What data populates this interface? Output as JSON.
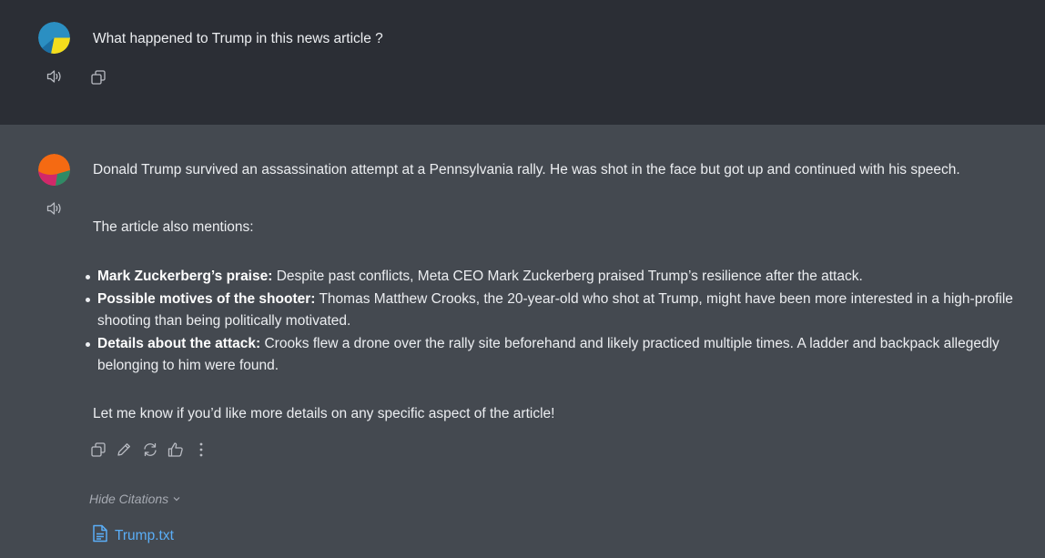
{
  "user_message": {
    "text": "What happened to Trump in this news article ?"
  },
  "assistant_message": {
    "intro": "Donald Trump survived an assassination attempt at a Pennsylvania rally. He was shot in the face but got up and continued with his speech.",
    "mentions_label": "The article also mentions:",
    "points": [
      {
        "title": "Mark Zuckerberg’s praise:",
        "text": " Despite past conflicts, Meta CEO Mark Zuckerberg praised Trump’s resilience after the attack."
      },
      {
        "title": "Possible motives of the shooter:",
        "text": " Thomas Matthew Crooks, the 20-year-old who shot at Trump, might have been more interested in a high-profile shooting than being politically motivated."
      },
      {
        "title": "Details about the attack:",
        "text": " Crooks flew a drone over the rally site beforehand and likely practiced multiple times. A ladder and backpack allegedly belonging to him were found."
      }
    ],
    "closing": "Let me know if you’d like more details on any specific aspect of the article!"
  },
  "citations": {
    "toggle_label": "Hide Citations",
    "files": [
      {
        "name": "Trump.txt"
      }
    ]
  },
  "icons": {
    "user_actions": [
      "speaker-icon",
      "copy-icon"
    ],
    "assistant_actions": [
      "copy-icon",
      "edit-icon",
      "regenerate-icon",
      "thumbs-up-icon",
      "more-icon"
    ]
  },
  "colors": {
    "user_bg": "#2b2e35",
    "assistant_bg": "#444950",
    "link": "#5aaef7"
  }
}
